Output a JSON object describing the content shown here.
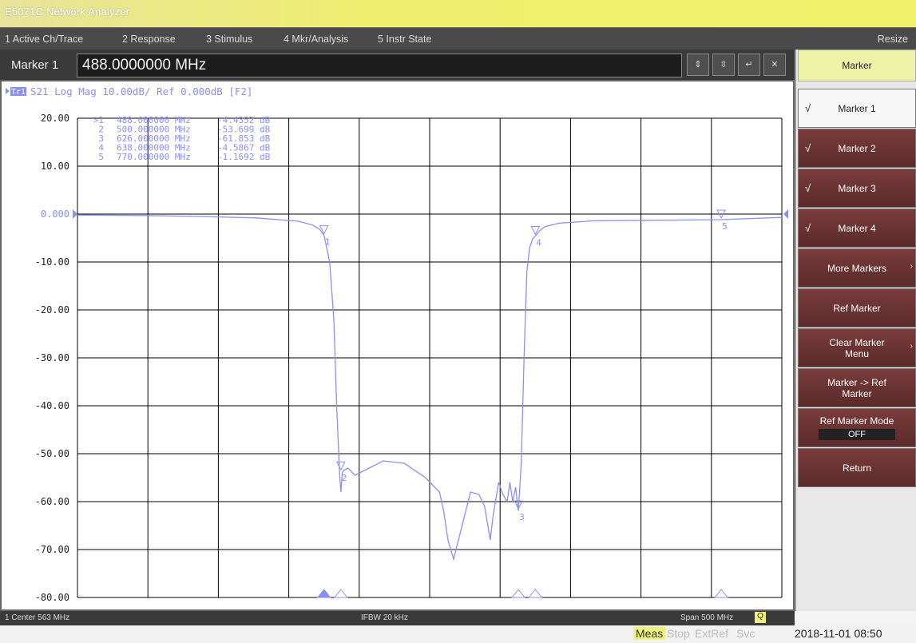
{
  "window": {
    "title": "E5071C Network Analyzer"
  },
  "menu": {
    "items": [
      "1 Active Ch/Trace",
      "2 Response",
      "3 Stimulus",
      "4 Mkr/Analysis",
      "5 Instr State"
    ],
    "resize": "Resize"
  },
  "marker_entry": {
    "label": "Marker 1",
    "value": "488.0000000 MHz"
  },
  "trace_header": {
    "tr": "Tr1",
    "text": "S21 Log Mag 10.00dB/ Ref 0.000dB [F2]"
  },
  "marker_table": [
    {
      "num": ">1",
      "freq": "488.000000 MHz",
      "val": "-4.4352 dB"
    },
    {
      "num": "2",
      "freq": "500.000000 MHz",
      "val": "-53.699 dB"
    },
    {
      "num": "3",
      "freq": "626.000000 MHz",
      "val": "-61.853 dB"
    },
    {
      "num": "4",
      "freq": "638.000000 MHz",
      "val": "-4.5867 dB"
    },
    {
      "num": "5",
      "freq": "770.000000 MHz",
      "val": "-1.1692 dB"
    }
  ],
  "status": {
    "center": "1 Center 563 MHz",
    "ifbw": "IFBW 20 kHz",
    "span": "Span 500 MHz"
  },
  "softkeys": {
    "header": "Marker",
    "items": [
      {
        "label": "Marker 1",
        "check": "√"
      },
      {
        "label": "Marker 2",
        "check": "√"
      },
      {
        "label": "Marker 3",
        "check": "√"
      },
      {
        "label": "Marker 4",
        "check": "√"
      },
      {
        "label": "More Markers",
        "check": ""
      },
      {
        "label": "Ref Marker",
        "check": ""
      },
      {
        "label": "Clear Marker Menu",
        "check": ""
      },
      {
        "label": "Marker -> Ref Marker",
        "check": ""
      },
      {
        "label": "Ref Marker Mode",
        "value": "OFF"
      },
      {
        "label": "Return",
        "check": ""
      }
    ]
  },
  "bottom": {
    "meas": "Meas",
    "stop": "Stop",
    "extref": "ExtRef",
    "svc": "Svc",
    "datetime": "2018-11-01 08:50"
  },
  "colors": {
    "trace": "#8b8ff0",
    "grid": "#000000",
    "softkey": "#5e2c2c"
  },
  "chart_data": {
    "type": "line",
    "series": [
      {
        "name": "S21",
        "x": [
          313,
          360,
          400,
          440,
          470,
          480,
          485,
          488,
          492,
          495,
          497,
          499,
          500,
          501,
          502,
          505,
          510,
          520,
          530,
          545,
          560,
          570,
          573,
          576,
          580,
          586,
          592,
          598,
          602,
          606,
          608,
          612,
          615,
          618,
          620,
          622,
          624,
          626,
          628,
          630,
          632,
          634,
          636,
          638,
          641,
          645,
          655,
          680,
          720,
          770,
          813
        ],
        "y": [
          -0.2,
          -0.3,
          -0.5,
          -0.8,
          -1.5,
          -2.3,
          -3.2,
          -4.4,
          -10,
          -22,
          -40,
          -54,
          -58,
          -54,
          -53.5,
          -53,
          -54.5,
          -53,
          -51.5,
          -52,
          -55,
          -58,
          -62,
          -68,
          -72,
          -65,
          -58,
          -58.5,
          -61,
          -68,
          -63,
          -56,
          -58.5,
          -60,
          -56,
          -60,
          -57,
          -61.9,
          -52,
          -30,
          -12,
          -7,
          -5.2,
          -4.6,
          -3.5,
          -2.6,
          -1.9,
          -1.4,
          -1.3,
          -1.17,
          -0.7
        ]
      }
    ],
    "ylabels": [
      "20.00",
      "10.00",
      "0.000",
      "-10.00",
      "-20.00",
      "-30.00",
      "-40.00",
      "-50.00",
      "-60.00",
      "-70.00",
      "-80.00"
    ],
    "xlim": [
      313,
      813
    ],
    "ylim": [
      -80,
      20
    ],
    "grid": true,
    "markers": [
      {
        "id": "1",
        "x": 488,
        "y": -4.4352
      },
      {
        "id": "2",
        "x": 500,
        "y": -53.699
      },
      {
        "id": "3",
        "x": 626,
        "y": -61.853
      },
      {
        "id": "4",
        "x": 638,
        "y": -4.5867
      },
      {
        "id": "5",
        "x": 770,
        "y": -1.1692
      }
    ]
  }
}
